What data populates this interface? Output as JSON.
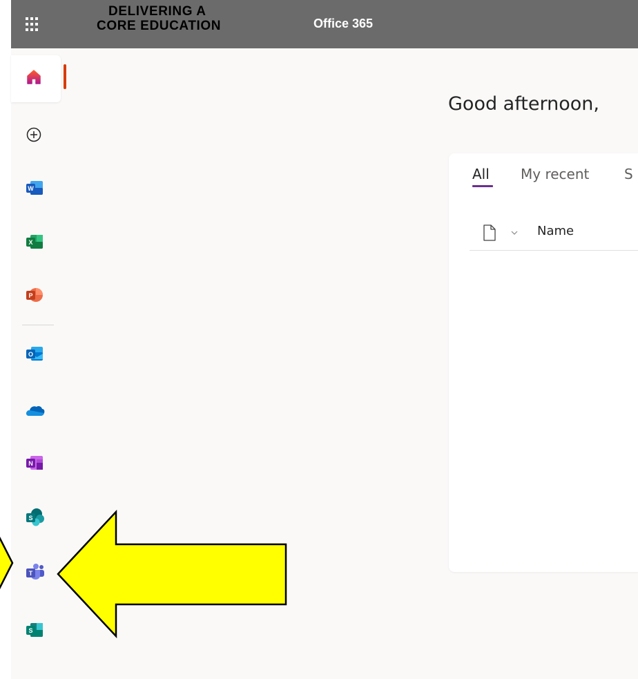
{
  "header": {
    "brand_line1": "DELIVERING A",
    "brand_line2": "CORE EDUCATION",
    "app_name": "Office 365",
    "background": "#6b6b6b"
  },
  "rail": {
    "items": [
      {
        "name": "home-icon",
        "color": "#d83b01"
      },
      {
        "name": "create-icon"
      },
      {
        "name": "word-icon",
        "color": "#185abd",
        "letter": "W"
      },
      {
        "name": "excel-icon",
        "color": "#107c41",
        "letter": "X"
      },
      {
        "name": "powerpoint-icon",
        "color": "#c43e1c",
        "letter": "P"
      },
      {
        "name": "outlook-icon",
        "color": "#0078d4",
        "letter": "O"
      },
      {
        "name": "onedrive-icon",
        "color": "#0364b8"
      },
      {
        "name": "onenote-icon",
        "color": "#7719aa",
        "letter": "N"
      },
      {
        "name": "sharepoint-icon",
        "color": "#03787c",
        "letter": "S"
      },
      {
        "name": "teams-icon",
        "color": "#5059c9",
        "letter": "T"
      },
      {
        "name": "sway-icon",
        "color": "#008272",
        "letter": "S"
      }
    ]
  },
  "main": {
    "greeting": "Good afternoon,",
    "tabs": [
      {
        "label": "All",
        "active": true
      },
      {
        "label": "My recent",
        "active": false
      },
      {
        "label": "S",
        "active": false
      }
    ],
    "column_header": "Name"
  },
  "annotation": {
    "arrow_color": "#ffff00",
    "arrow_target": "teams-icon"
  }
}
